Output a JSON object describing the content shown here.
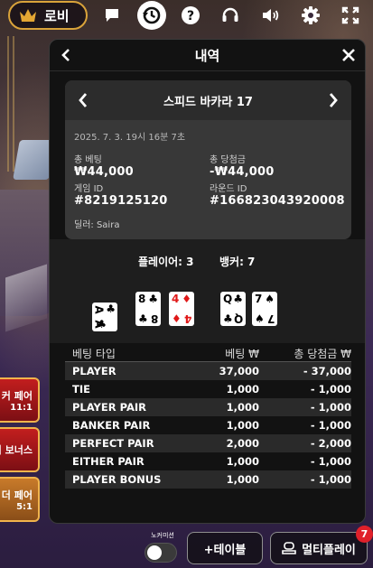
{
  "topbar": {
    "lobby_label": "로비",
    "icons": [
      "crown-icon",
      "chat-icon",
      "history-icon",
      "help-icon",
      "headset-icon",
      "volume-icon",
      "settings-icon",
      "fullscreen-icon"
    ]
  },
  "side_bets": [
    {
      "name": "커 페어",
      "odds": "11:1"
    },
    {
      "name": "어 보너스",
      "odds": ""
    },
    {
      "name": "더 페어",
      "odds": "5:1"
    }
  ],
  "panel": {
    "title": "내역",
    "round": {
      "title": "스피드 바카라 17",
      "date": "2025. 7. 3. 19시 16분 7초",
      "total_bet_label": "총 베팅",
      "total_bet_value": "₩44,000",
      "total_win_label": "총 당첨금",
      "total_win_value": "-₩44,000",
      "game_id_label": "게임 ID",
      "game_id_value": "#8219125120",
      "round_id_label": "라운드 ID",
      "round_id_value": "#166823043920008",
      "dealer": "딜러: Saira"
    },
    "result": {
      "player_label": "플레이어: 3",
      "banker_label": "뱅커: 7",
      "player_cards": [
        {
          "rank": "A",
          "suit": "♣",
          "color": "black",
          "orientation": "sideways"
        },
        {
          "rank": "8",
          "suit": "♣",
          "color": "black",
          "orientation": "upright"
        },
        {
          "rank": "4",
          "suit": "♦",
          "color": "red",
          "orientation": "upright"
        }
      ],
      "banker_cards": [
        {
          "rank": "Q",
          "suit": "♣",
          "color": "black",
          "orientation": "upright"
        },
        {
          "rank": "7",
          "suit": "♠",
          "color": "black",
          "orientation": "upright"
        }
      ]
    },
    "bets": {
      "headers": [
        "베팅 타입",
        "베팅 ₩",
        "총 당첨금 ₩"
      ],
      "rows": [
        {
          "type": "PLAYER",
          "bet": "37,000",
          "win": "- 37,000"
        },
        {
          "type": "TIE",
          "bet": "1,000",
          "win": "- 1,000"
        },
        {
          "type": "PLAYER PAIR",
          "bet": "1,000",
          "win": "- 1,000"
        },
        {
          "type": "BANKER PAIR",
          "bet": "1,000",
          "win": "- 1,000"
        },
        {
          "type": "PERFECT PAIR",
          "bet": "2,000",
          "win": "- 2,000"
        },
        {
          "type": "EITHER PAIR",
          "bet": "1,000",
          "win": "- 1,000"
        },
        {
          "type": "PLAYER BONUS",
          "bet": "1,000",
          "win": "- 1,000"
        }
      ]
    }
  },
  "bottom": {
    "toggle_label": "노커미션",
    "add_table_label": "+테이블",
    "multiplay_label": "멀티플레이",
    "badge_count": "7"
  }
}
